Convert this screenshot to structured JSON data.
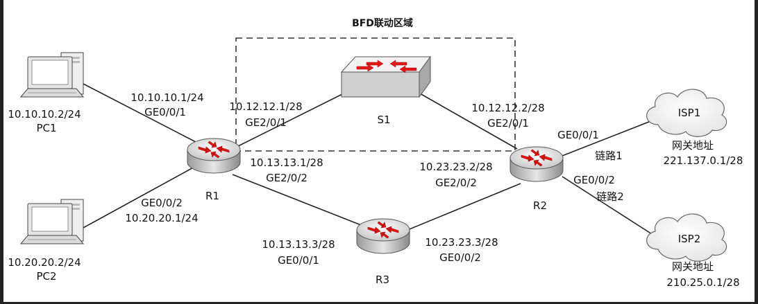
{
  "region": {
    "title": "BFD联动区域"
  },
  "nodes": {
    "pc1": {
      "name": "PC1",
      "ip": "10.10.10.2/24"
    },
    "pc2": {
      "name": "PC2",
      "ip": "10.20.20.2/24"
    },
    "r1": {
      "name": "R1"
    },
    "r2": {
      "name": "R2"
    },
    "r3": {
      "name": "R3"
    },
    "s1": {
      "name": "S1"
    },
    "isp1": {
      "name": "ISP1",
      "gw_label": "网关地址",
      "gw_ip": "221.137.0.1/28"
    },
    "isp2": {
      "name": "ISP2",
      "gw_label": "网关地址",
      "gw_ip": "210.25.0.1/28"
    }
  },
  "interfaces": {
    "r1_pc1_ip": "10.10.10.1/24",
    "r1_pc1_if": "GE0/0/1",
    "r1_s1_ip": "10.12.12.1/28",
    "r1_s1_if": "GE2/0/1",
    "r1_r3_ip": "10.13.13.1/28",
    "r1_r3_if": "GE2/0/2",
    "r1_pc2_if": "GE0/0/2",
    "r1_pc2_ip": "10.20.20.1/24",
    "r2_s1_ip": "10.12.12.2/28",
    "r2_s1_if": "GE2/0/1",
    "r2_r3_ip": "10.23.23.2/28",
    "r2_r3_if": "GE2/0/2",
    "r2_isp1_if": "GE0/0/1",
    "r2_isp1_link": "链路1",
    "r2_isp2_if": "GE0/0/2",
    "r2_isp2_link": "链路2",
    "r3_r1_ip": "10.13.13.3/28",
    "r3_r1_if": "GE0/0/1",
    "r3_r2_ip": "10.23.23.3/28",
    "r3_r2_if": "GE0/0/2"
  },
  "colors": {
    "arrow": "#e01818",
    "device_body": "#d4d4d4",
    "device_top": "#eeeeee",
    "frame": "#222222"
  },
  "icons": {
    "pc": "desktop-computer-icon",
    "router": "router-icon",
    "switch": "switch-icon",
    "cloud": "cloud-icon"
  }
}
